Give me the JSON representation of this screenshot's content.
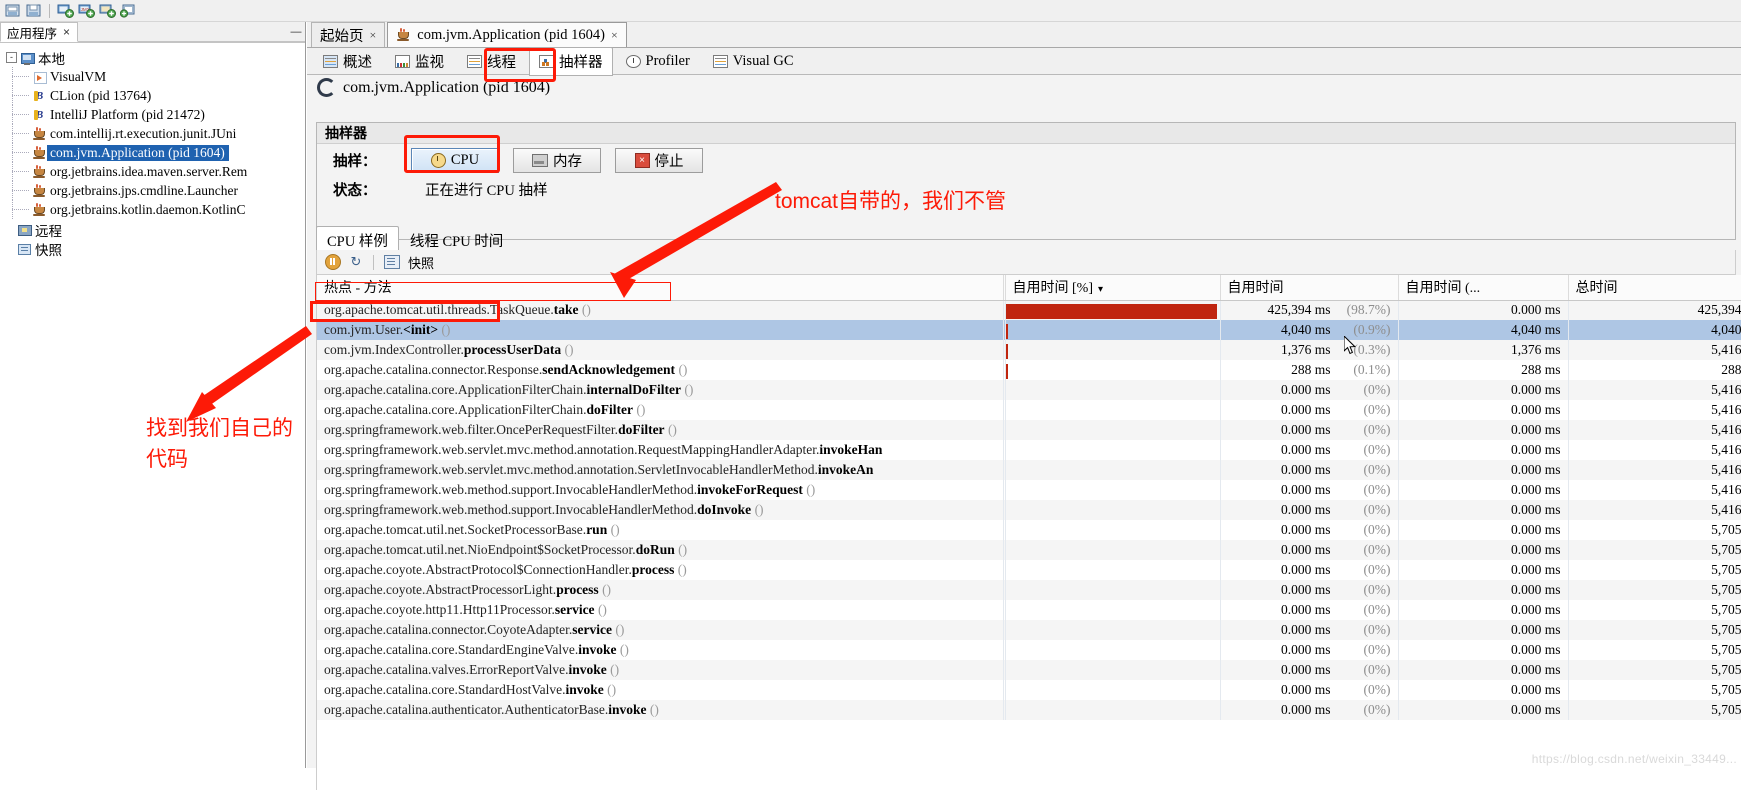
{
  "toolbar": {
    "buttons": [
      {
        "name": "open-icon",
        "label": "open"
      },
      {
        "name": "save-icon",
        "label": "save"
      },
      {
        "name": "add-local-host-icon",
        "label": "add-local"
      },
      {
        "name": "add-jmx-connection-icon",
        "label": "add-jmx"
      },
      {
        "name": "add-remote-host-icon",
        "label": "add-remote"
      },
      {
        "name": "add-vm-coredump-icon",
        "label": "add-coredump"
      }
    ]
  },
  "left_panel": {
    "tab_label": "应用程序",
    "tab_close": "×",
    "minimize": "—",
    "tree": {
      "root": "本地",
      "root_expander": "-",
      "children": [
        {
          "label": "VisualVM",
          "icon": "visualvm-icon"
        },
        {
          "label": "CLion (pid 13764)",
          "icon": "clion-icon"
        },
        {
          "label": "IntelliJ Platform (pid 21472)",
          "icon": "clion-icon"
        },
        {
          "label": "com.intellij.rt.execution.junit.JUni",
          "icon": "java-icon"
        },
        {
          "label": "com.jvm.Application (pid 1604)",
          "icon": "java-icon",
          "selected": true
        },
        {
          "label": "org.jetbrains.idea.maven.server.Rem",
          "icon": "java-icon"
        },
        {
          "label": "org.jetbrains.jps.cmdline.Launcher",
          "icon": "java-icon"
        },
        {
          "label": "org.jetbrains.kotlin.daemon.KotlinC",
          "icon": "java-icon"
        }
      ],
      "remote": "远程",
      "snapshots": "快照"
    }
  },
  "doc_tabs": [
    {
      "label": "起始页",
      "icon": null,
      "active": false,
      "close": "×"
    },
    {
      "label": "com.jvm.Application (pid 1604)",
      "icon": "java-icon",
      "active": true,
      "close": "×"
    }
  ],
  "sub_tabs": [
    {
      "label": "概述",
      "icon": "overview-icon",
      "active": false
    },
    {
      "label": "监视",
      "icon": "monitor-icon",
      "active": false
    },
    {
      "label": "线程",
      "icon": "threads-icon",
      "active": false
    },
    {
      "label": "抽样器",
      "icon": "sampler-icon",
      "active": true
    },
    {
      "label": "Profiler",
      "icon": "profiler-icon",
      "active": false
    },
    {
      "label": "Visual GC",
      "icon": "visualgc-icon",
      "active": false
    }
  ],
  "app_header": {
    "title": "com.jvm.Application (pid 1604)"
  },
  "sampler": {
    "panel_title": "抽样器",
    "sample_label": "抽样：",
    "cpu_button": "CPU",
    "memory_button": "内存",
    "stop_button": "停止",
    "status_label": "状态：",
    "status_value": "正在进行 CPU 抽样"
  },
  "result_tabs": [
    {
      "label": "CPU 样例",
      "active": true
    },
    {
      "label": "线程 CPU 时间",
      "active": false
    }
  ],
  "snapshot_bar": {
    "pause_tooltip": "暂停",
    "refresh_tooltip": "刷新",
    "snapshot_label": "快照"
  },
  "table": {
    "columns": [
      "热点 - 方法",
      "",
      "自用时间 [%]",
      "自用时间",
      "自用时间 (...",
      "总时间"
    ],
    "sort_indicator": "▾",
    "rows": [
      {
        "method": "org.apache.tomcat.util.threads.TaskQueue.",
        "name": "take",
        "args": "()",
        "bar_pct": 98.7,
        "self_pct": "(98.7%)",
        "self_time": "425,394 ms",
        "self_time_cpu": "0.000 ms",
        "total_time": "425,394",
        "highlight": false
      },
      {
        "method": "com.jvm.User.",
        "name": "<init>",
        "args": "()",
        "bar_pct": 0.9,
        "self_pct": "(0.9%)",
        "self_time": "4,040 ms",
        "self_time_cpu": "4,040 ms",
        "total_time": "4,040",
        "highlight": true
      },
      {
        "method": "com.jvm.IndexController.",
        "name": "processUserData",
        "args": "()",
        "bar_pct": 0.3,
        "self_pct": "(0.3%)",
        "self_time": "1,376 ms",
        "self_time_cpu": "1,376 ms",
        "total_time": "5,416",
        "highlight": false
      },
      {
        "method": "org.apache.catalina.connector.Response.",
        "name": "sendAcknowledgement",
        "args": "()",
        "bar_pct": 0.1,
        "self_pct": "(0.1%)",
        "self_time": "288 ms",
        "self_time_cpu": "288 ms",
        "total_time": "288",
        "highlight": false
      },
      {
        "method": "org.apache.catalina.core.ApplicationFilterChain.",
        "name": "internalDoFilter",
        "args": "()",
        "bar_pct": 0,
        "self_pct": "(0%)",
        "self_time": "0.000 ms",
        "self_time_cpu": "0.000 ms",
        "total_time": "5,416",
        "highlight": false
      },
      {
        "method": "org.apache.catalina.core.ApplicationFilterChain.",
        "name": "doFilter",
        "args": "()",
        "bar_pct": 0,
        "self_pct": "(0%)",
        "self_time": "0.000 ms",
        "self_time_cpu": "0.000 ms",
        "total_time": "5,416",
        "highlight": false
      },
      {
        "method": "org.springframework.web.filter.OncePerRequestFilter.",
        "name": "doFilter",
        "args": "()",
        "bar_pct": 0,
        "self_pct": "(0%)",
        "self_time": "0.000 ms",
        "self_time_cpu": "0.000 ms",
        "total_time": "5,416",
        "highlight": false
      },
      {
        "method": "org.springframework.web.servlet.mvc.method.annotation.RequestMappingHandlerAdapter.",
        "name": "invokeHan",
        "args": "",
        "bar_pct": 0,
        "self_pct": "(0%)",
        "self_time": "0.000 ms",
        "self_time_cpu": "0.000 ms",
        "total_time": "5,416",
        "highlight": false
      },
      {
        "method": "org.springframework.web.servlet.mvc.method.annotation.ServletInvocableHandlerMethod.",
        "name": "invokeAn",
        "args": "",
        "bar_pct": 0,
        "self_pct": "(0%)",
        "self_time": "0.000 ms",
        "self_time_cpu": "0.000 ms",
        "total_time": "5,416",
        "highlight": false
      },
      {
        "method": "org.springframework.web.method.support.InvocableHandlerMethod.",
        "name": "invokeForRequest",
        "args": "()",
        "bar_pct": 0,
        "self_pct": "(0%)",
        "self_time": "0.000 ms",
        "self_time_cpu": "0.000 ms",
        "total_time": "5,416",
        "highlight": false
      },
      {
        "method": "org.springframework.web.method.support.InvocableHandlerMethod.",
        "name": "doInvoke",
        "args": "()",
        "bar_pct": 0,
        "self_pct": "(0%)",
        "self_time": "0.000 ms",
        "self_time_cpu": "0.000 ms",
        "total_time": "5,416",
        "highlight": false
      },
      {
        "method": "org.apache.tomcat.util.net.SocketProcessorBase.",
        "name": "run",
        "args": "()",
        "bar_pct": 0,
        "self_pct": "(0%)",
        "self_time": "0.000 ms",
        "self_time_cpu": "0.000 ms",
        "total_time": "5,705",
        "highlight": false
      },
      {
        "method": "org.apache.tomcat.util.net.NioEndpoint$SocketProcessor.",
        "name": "doRun",
        "args": "()",
        "bar_pct": 0,
        "self_pct": "(0%)",
        "self_time": "0.000 ms",
        "self_time_cpu": "0.000 ms",
        "total_time": "5,705",
        "highlight": false
      },
      {
        "method": "org.apache.coyote.AbstractProtocol$ConnectionHandler.",
        "name": "process",
        "args": "()",
        "bar_pct": 0,
        "self_pct": "(0%)",
        "self_time": "0.000 ms",
        "self_time_cpu": "0.000 ms",
        "total_time": "5,705",
        "highlight": false
      },
      {
        "method": "org.apache.coyote.AbstractProcessorLight.",
        "name": "process",
        "args": "()",
        "bar_pct": 0,
        "self_pct": "(0%)",
        "self_time": "0.000 ms",
        "self_time_cpu": "0.000 ms",
        "total_time": "5,705",
        "highlight": false
      },
      {
        "method": "org.apache.coyote.http11.Http11Processor.",
        "name": "service",
        "args": "()",
        "bar_pct": 0,
        "self_pct": "(0%)",
        "self_time": "0.000 ms",
        "self_time_cpu": "0.000 ms",
        "total_time": "5,705",
        "highlight": false
      },
      {
        "method": "org.apache.catalina.connector.CoyoteAdapter.",
        "name": "service",
        "args": "()",
        "bar_pct": 0,
        "self_pct": "(0%)",
        "self_time": "0.000 ms",
        "self_time_cpu": "0.000 ms",
        "total_time": "5,705",
        "highlight": false
      },
      {
        "method": "org.apache.catalina.core.StandardEngineValve.",
        "name": "invoke",
        "args": "()",
        "bar_pct": 0,
        "self_pct": "(0%)",
        "self_time": "0.000 ms",
        "self_time_cpu": "0.000 ms",
        "total_time": "5,705",
        "highlight": false
      },
      {
        "method": "org.apache.catalina.valves.ErrorReportValve.",
        "name": "invoke",
        "args": "()",
        "bar_pct": 0,
        "self_pct": "(0%)",
        "self_time": "0.000 ms",
        "self_time_cpu": "0.000 ms",
        "total_time": "5,705",
        "highlight": false
      },
      {
        "method": "org.apache.catalina.core.StandardHostValve.",
        "name": "invoke",
        "args": "()",
        "bar_pct": 0,
        "self_pct": "(0%)",
        "self_time": "0.000 ms",
        "self_time_cpu": "0.000 ms",
        "total_time": "5,705",
        "highlight": false
      },
      {
        "method": "org.apache.catalina.authenticator.AuthenticatorBase.",
        "name": "invoke",
        "args": "()",
        "bar_pct": 0,
        "self_pct": "(0%)",
        "self_time": "0.000 ms",
        "self_time_cpu": "0.000 ms",
        "total_time": "5,705",
        "highlight": false
      }
    ]
  },
  "annotations": [
    {
      "name": "annotation-tomcat-note",
      "text": "tomcat自带的，我们不管"
    },
    {
      "name": "annotation-our-code-line1",
      "text": "找到我们自己的"
    },
    {
      "name": "annotation-our-code-line2",
      "text": "代码"
    }
  ],
  "watermark": "https://blog.csdn.net/weixin_33449...",
  "colors": {
    "accent_red": "#fd1a07",
    "bar_red": "#c0250f",
    "selection_blue": "#1f62b0",
    "row_selection": "#aec6e4"
  }
}
